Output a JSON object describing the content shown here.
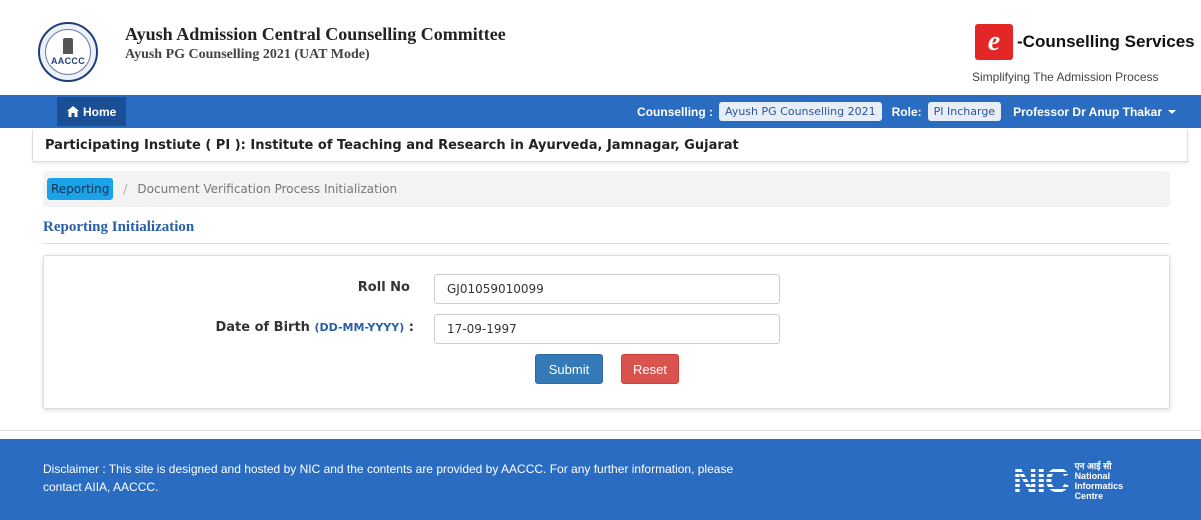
{
  "header": {
    "emblem_abbr": "AACCC",
    "title": "Ayush Admission Central Counselling Committee",
    "subtitle": "Ayush PG Counselling 2021 (UAT Mode)",
    "brand_letter": "e",
    "brand_name": "-Counselling Services",
    "brand_tagline": "Simplifying The Admission Process"
  },
  "navbar": {
    "home_label": "Home",
    "counselling_label": "Counselling :",
    "counselling_value": "Ayush PG Counselling 2021",
    "role_label": "Role:",
    "role_value": "PI Incharge",
    "user_name": "Professor Dr Anup Thakar"
  },
  "pi_bar": {
    "text": "Participating Instiute ( PI ): Institute of Teaching and Research in Ayurveda, Jamnagar, Gujarat"
  },
  "breadcrumb": {
    "active": "Reporting",
    "separator": "/",
    "current": "Document Verification Process Initialization"
  },
  "section": {
    "title": "Reporting Initialization"
  },
  "form": {
    "roll_label": "Roll No",
    "roll_value": "GJ01059010099",
    "dob_label": "Date of Birth",
    "dob_hint": "(DD-MM-YYYY)",
    "dob_colon": ":",
    "dob_value": "17-09-1997",
    "submit_label": "Submit",
    "reset_label": "Reset"
  },
  "footer": {
    "disclaimer": "Disclaimer : This site is designed and hosted by NIC and the contents are provided by AACCC. For any further information, please contact AIIA, AACCC.",
    "nic_mark": "NIC",
    "nic_hindi": "एन आई सी",
    "nic_line1": "National",
    "nic_line2": "Informatics",
    "nic_line3": "Centre"
  },
  "colors": {
    "nav_blue": "#2a6cc2",
    "home_dark": "#1b4f95",
    "crumb_active": "#1aa3e8",
    "submit": "#337ab7",
    "reset": "#d9534f",
    "brand_red": "#e32626"
  }
}
